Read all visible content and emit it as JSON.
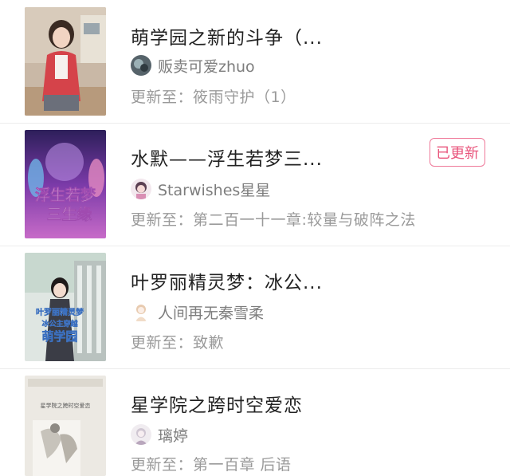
{
  "items": [
    {
      "title": "萌学园之新的斗争（...",
      "author": "贩卖可爱zhuo",
      "update": "更新至：筱雨守护（1）",
      "badge": ""
    },
    {
      "title": "水默——浮生若梦三...",
      "author": "Starwishes星星",
      "update": "更新至：第二百一十一章:较量与破阵之法",
      "badge": "已更新",
      "cover_text": "浮生若梦 三生缘"
    },
    {
      "title": "叶罗丽精灵梦：冰公...",
      "author": "人间再无秦雪柔",
      "update": "更新至：致歉",
      "badge": "",
      "cover_text": "叶罗丽精灵梦 冰公主穿越 萌学园"
    },
    {
      "title": "星学院之跨时空爱恋",
      "author": "璃婷",
      "update": "更新至：第一百章  后语",
      "badge": "",
      "cover_text": "星学院之跨时空爱恋"
    }
  ],
  "colors": {
    "badge": "#e9557c",
    "title": "#222222",
    "secondary": "#9a9a9a"
  }
}
